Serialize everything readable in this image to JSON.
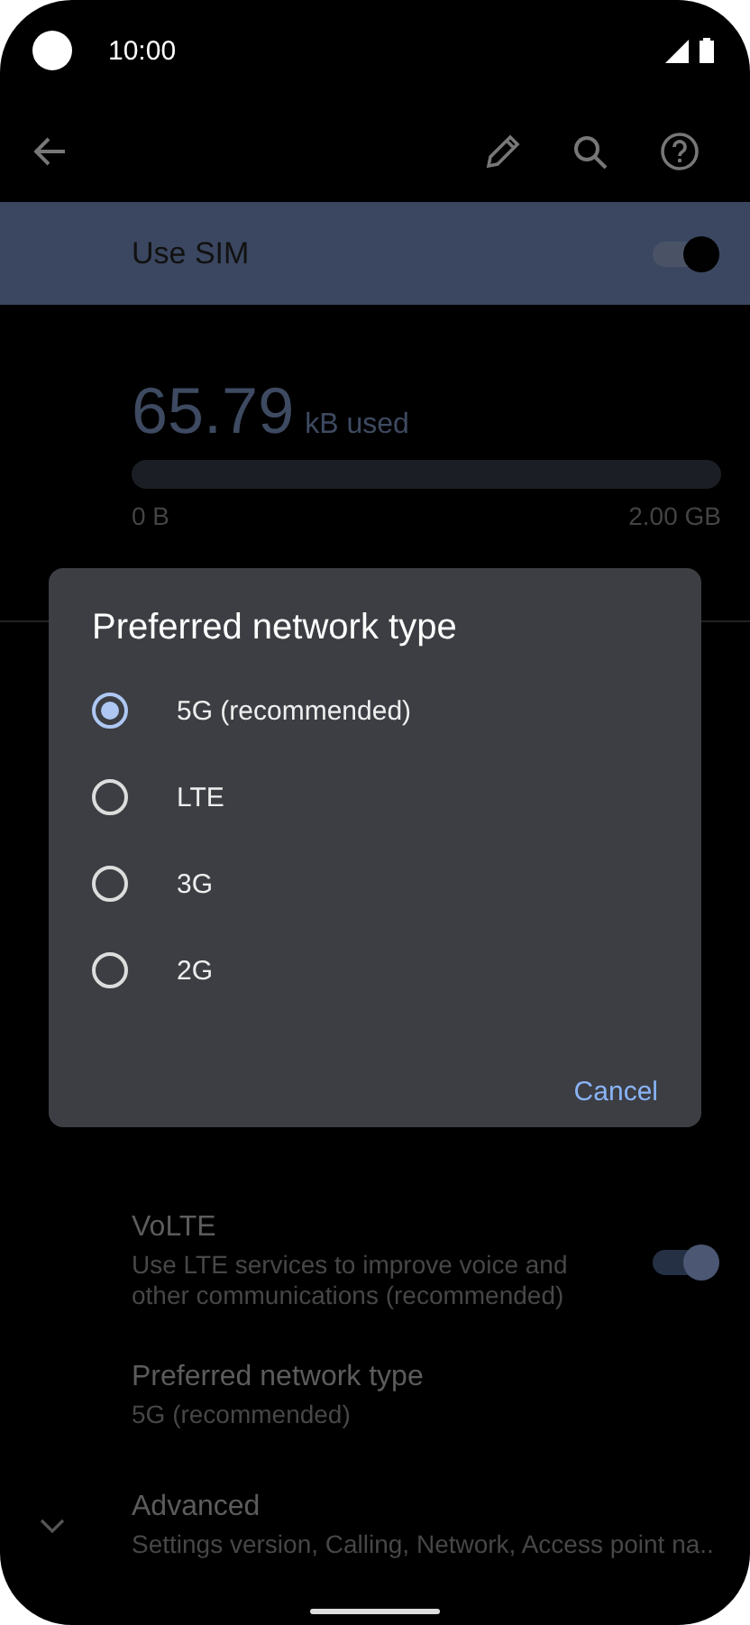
{
  "status_bar": {
    "time": "10:00"
  },
  "use_sim": {
    "label": "Use SIM",
    "on": true
  },
  "data_usage": {
    "amount": "65.79",
    "unit": "kB used",
    "level": 0,
    "min_label": "0 B",
    "max_label": "2.00 GB"
  },
  "settings": [
    {
      "kind": "toggle",
      "title": "VoLTE",
      "subtitle": "Use LTE services to improve voice and other communications (recommended)",
      "on": true
    },
    {
      "kind": "plain",
      "title": "Preferred network type",
      "subtitle": "5G (recommended)"
    },
    {
      "kind": "expand",
      "title": "Advanced",
      "subtitle": "Settings version, Calling, Network, Access point na.."
    }
  ],
  "dialog": {
    "title": "Preferred network type",
    "options": [
      {
        "label": "5G (recommended)",
        "selected": true
      },
      {
        "label": "LTE",
        "selected": false
      },
      {
        "label": "3G",
        "selected": false
      },
      {
        "label": "2G",
        "selected": false
      }
    ],
    "buttons": [
      "Cancel"
    ]
  }
}
